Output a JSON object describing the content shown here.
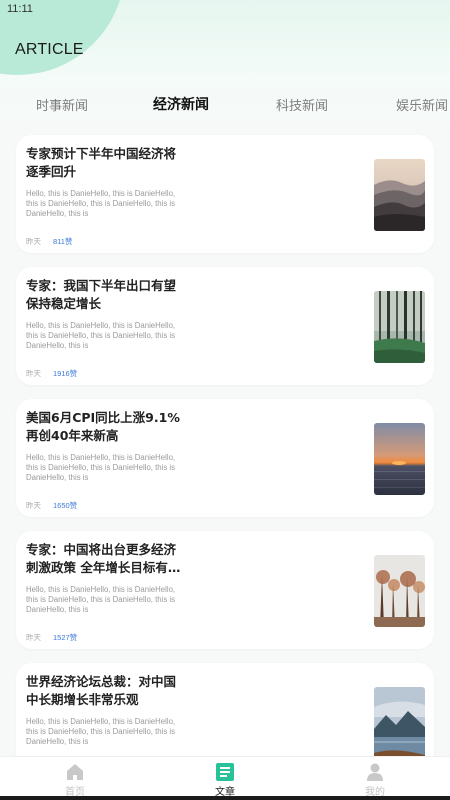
{
  "status_bar": {
    "time": "11:11"
  },
  "app": {
    "title": "ARTICLE"
  },
  "tabs": [
    {
      "label": "时事新闻",
      "active": false
    },
    {
      "label": "经济新闻",
      "active": true
    },
    {
      "label": "科技新闻",
      "active": false
    },
    {
      "label": "娱乐新闻",
      "active": false
    }
  ],
  "articles": [
    {
      "title": "专家预计下半年中国经济将逐季回升",
      "summary": "Hello, this is DanieHello, this is DanieHello, this is DanieHello, this is DanieHello, this is DanieHello, this is",
      "date": "昨天",
      "views": "811赞",
      "image": "misty-hills-photo"
    },
    {
      "title": "专家：我国下半年出口有望保持稳定增长",
      "summary": "Hello, this is DanieHello, this is DanieHello, this is DanieHello, this is DanieHello, this is DanieHello, this is",
      "date": "昨天",
      "views": "1916赞",
      "image": "forest-photo"
    },
    {
      "title": "美国6月CPI同比上涨9.1% 再创40年来新高",
      "summary": "Hello, this is DanieHello, this is DanieHello, this is DanieHello, this is DanieHello, this is DanieHello, this is",
      "date": "昨天",
      "views": "1650赞",
      "image": "sunset-sea-photo"
    },
    {
      "title": "专家：中国将出台更多经济刺激政策 全年增长目标有…",
      "summary": "Hello, this is DanieHello, this is DanieHello, this is DanieHello, this is DanieHello, this is DanieHello, this is",
      "date": "昨天",
      "views": "1527赞",
      "image": "autumn-trees-photo"
    },
    {
      "title": "世界经济论坛总裁：对中国中长期增长非常乐观",
      "summary": "Hello, this is DanieHello, this is DanieHello, this is DanieHello, this is DanieHello, this is DanieHello, this is",
      "date": "",
      "views": "",
      "image": "mountain-lake-photo"
    }
  ],
  "bottom_nav": [
    {
      "label": "首页",
      "icon": "home-icon",
      "active": false
    },
    {
      "label": "文章",
      "icon": "article-icon",
      "active": true
    },
    {
      "label": "我的",
      "icon": "profile-icon",
      "active": false
    }
  ],
  "colors": {
    "accent": "#3b79d9",
    "nav_active": "#27c19a",
    "header_blob": "#b9ead8",
    "card_bg": "#ffffff"
  }
}
